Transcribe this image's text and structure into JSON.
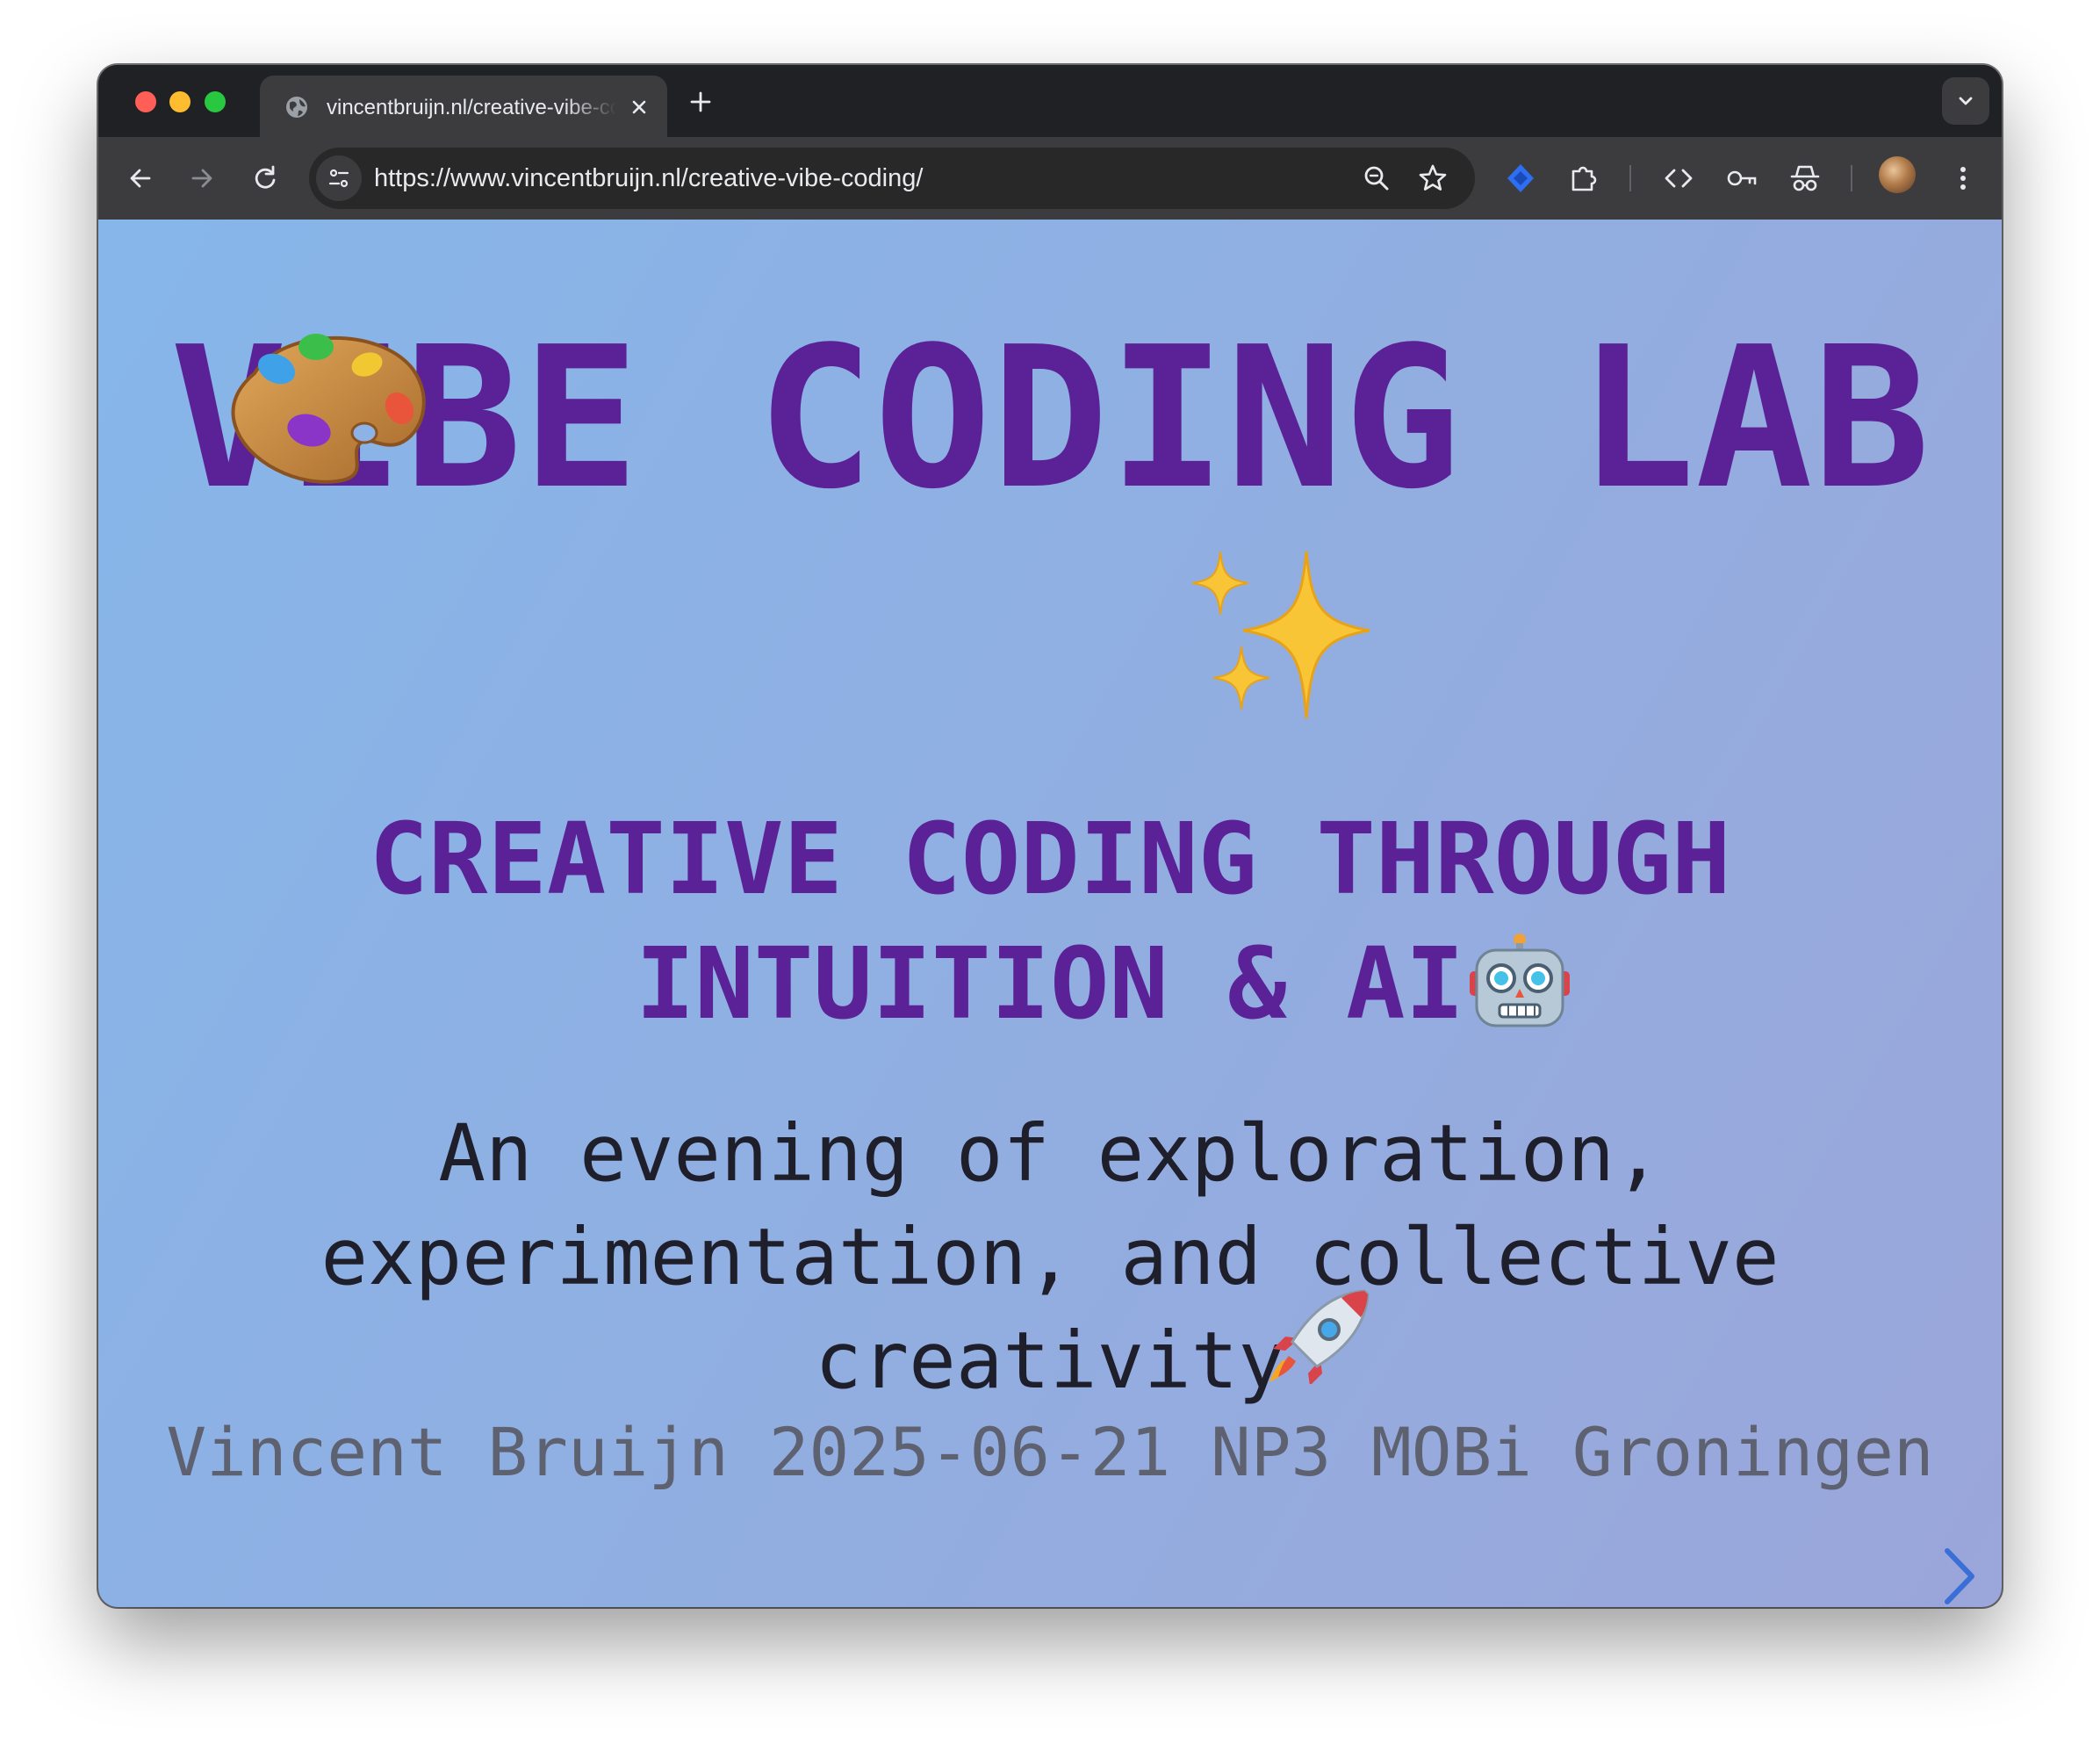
{
  "browser": {
    "tab": {
      "title": "vincentbruijn.nl/creative-vibe-coding/",
      "icon": "globe-icon"
    },
    "url": "https://www.vincentbruijn.nl/creative-vibe-coding/",
    "toolbar_icons": [
      "back-icon",
      "forward-icon",
      "reload-icon",
      "site-info-icon",
      "zoom-icon",
      "star-icon",
      "extension-diamond-icon",
      "puzzle-icon",
      "code-icon",
      "key-icon",
      "incognito-icon",
      "avatar",
      "more-vert-icon"
    ]
  },
  "slide": {
    "title": "VIBE CODING LAB",
    "title_emojis": [
      "artist-palette",
      "sparkles"
    ],
    "subtitle": "CREATIVE CODING THROUGH INTUITION & AI",
    "subtitle_emoji": "robot",
    "lead": "An evening of exploration, experimentation, and collective creativity",
    "lead_emoji": "rocket",
    "byline": "Vincent Bruijn 2025-06-21 NP3 MOBi Groningen"
  },
  "colors": {
    "accent_purple": "#5b2196",
    "text_dark": "#1f1f2b",
    "byline_gray": "#5e6270",
    "nav_arrow": "#3a6fd8",
    "background_start": "#86b6ea",
    "background_end": "#9ba6da"
  }
}
